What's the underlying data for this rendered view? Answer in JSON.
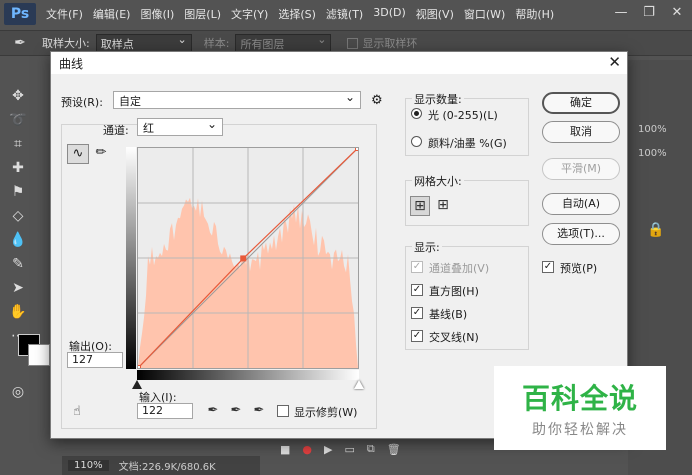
{
  "app": {
    "logo": "Ps",
    "menus": [
      "文件(F)",
      "编辑(E)",
      "图像(I)",
      "图层(L)",
      "文字(Y)",
      "选择(S)",
      "滤镜(T)",
      "3D(D)",
      "视图(V)",
      "窗口(W)",
      "帮助(H)"
    ],
    "window_controls": [
      "—",
      "❐",
      "✕"
    ]
  },
  "options_bar": {
    "sample_size_label": "取样大小:",
    "sample_size_value": "取样点",
    "sample_label": "样本:",
    "sample_value": "所有图层",
    "show_ring_label": "显示取样环"
  },
  "right_panel": {
    "opacity_1": "100%",
    "opacity_2": "100%"
  },
  "status_bar": {
    "zoom": "110%",
    "doc_info": "文档:226.9K/680.6K"
  },
  "dialog": {
    "title": "曲线",
    "close_icon": "✕",
    "preset_label": "预设(R):",
    "preset_value": "自定",
    "channel_label": "通道:",
    "channel_value": "红",
    "output_label": "输出(O):",
    "output_value": "127",
    "input_label": "输入(I):",
    "input_value": "122",
    "show_clipping_label": "显示修剪(W)",
    "display_amount": {
      "legend": "显示数量:",
      "light_label": "光 (0-255)(L)",
      "pigment_label": "颜料/油墨 %(G)",
      "selected": "light"
    },
    "grid_size": {
      "legend": "网格大小:"
    },
    "show": {
      "legend": "显示:",
      "channel_overlays": {
        "label": "通道叠加(V)",
        "checked": true,
        "disabled": true
      },
      "histogram": {
        "label": "直方图(H)",
        "checked": true
      },
      "baseline": {
        "label": "基线(B)",
        "checked": true
      },
      "intersection": {
        "label": "交叉线(N)",
        "checked": true
      }
    },
    "buttons": {
      "ok": "确定",
      "cancel": "取消",
      "smooth": "平滑(M)",
      "auto": "自动(A)",
      "options": "选项(T)...",
      "preview": "预览(P)"
    },
    "curve": {
      "points": [
        [
          0,
          0
        ],
        [
          122,
          127
        ],
        [
          255,
          255
        ]
      ],
      "color": "#e85a3a",
      "histogram_color": "#ffc4ad"
    }
  },
  "watermark": {
    "title": "百科全说",
    "subtitle": "助你轻松解决",
    "color": "#2fb347"
  }
}
